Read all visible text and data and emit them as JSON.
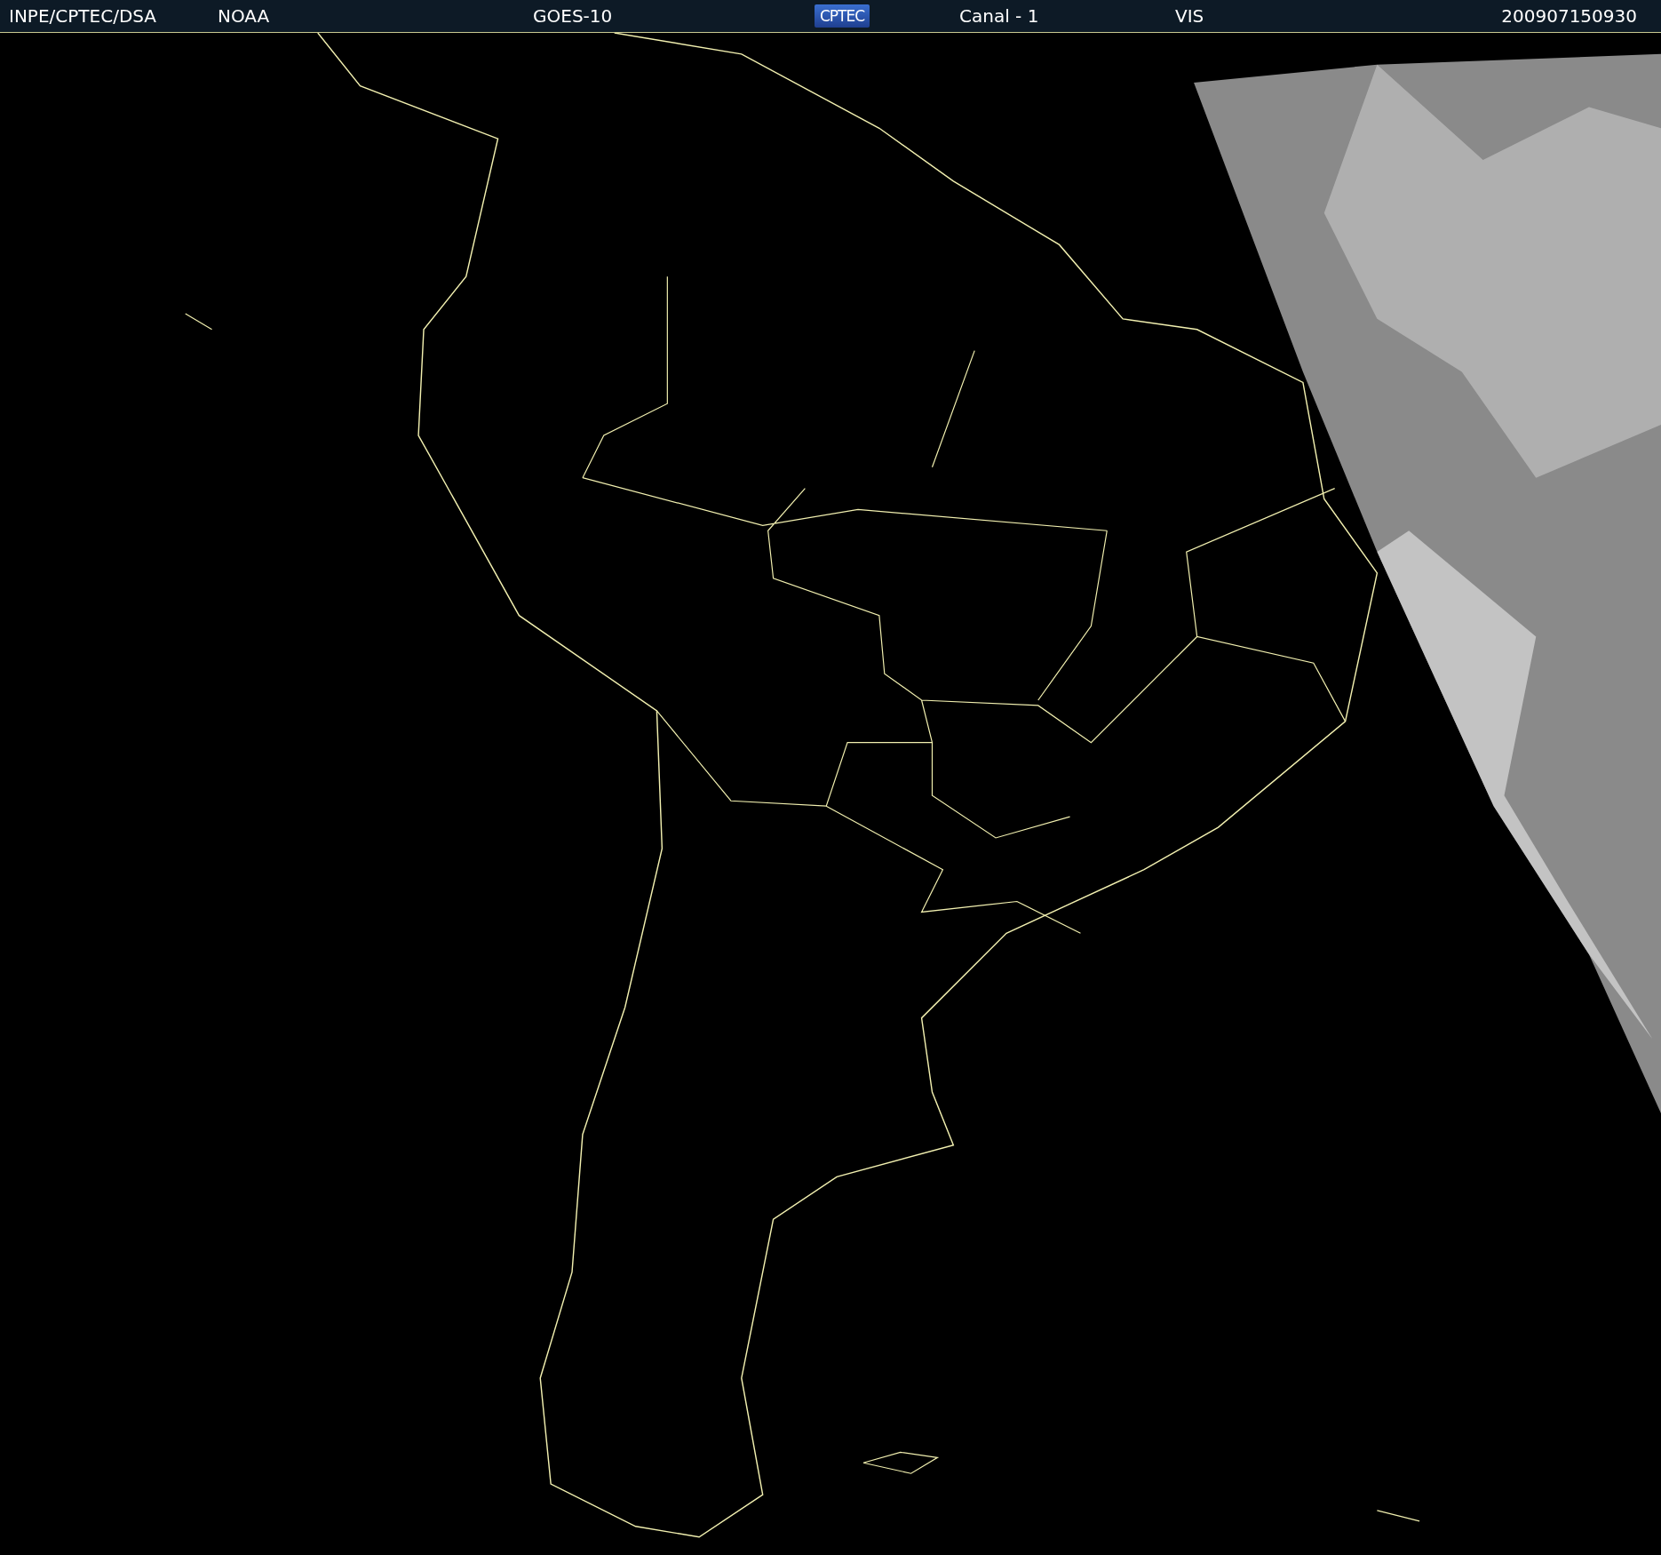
{
  "header": {
    "source": "INPE/CPTEC/DSA",
    "agency": "NOAA",
    "satellite": "GOES-10",
    "logo": "CPTEC",
    "channel": "Canal - 1",
    "band": "VIS",
    "timestamp": "200907150930"
  }
}
